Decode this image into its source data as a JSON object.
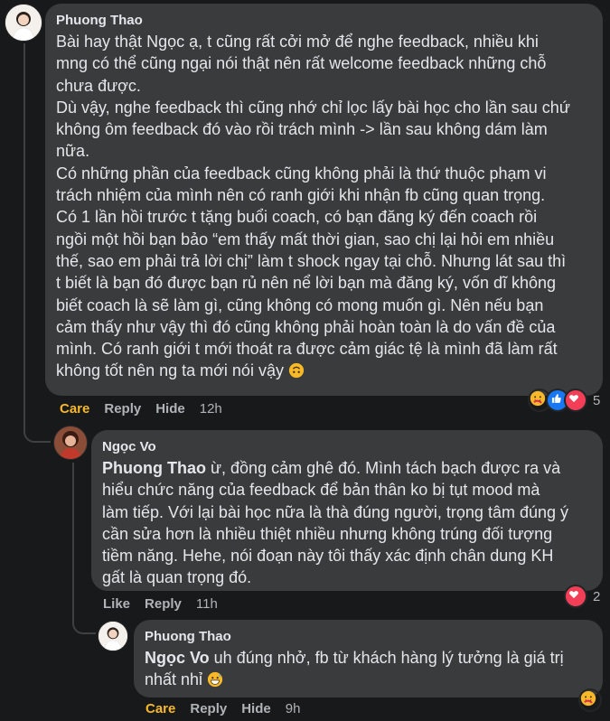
{
  "comments": [
    {
      "author": "Phuong Thao",
      "text": "Bài hay thật Ngọc ạ, t cũng rất cởi mở để nghe feedback, nhiều khi\nmng có thể cũng ngại nói thật nên rất welcome feedback những chỗ\nchưa được.\nDù vậy, nghe feedback thì cũng nhớ chỉ lọc lấy bài học cho lần sau chứ\nkhông ôm feedback đó vào rồi trách mình -> lần sau không dám làm\nnữa.\nCó những phần của feedback cũng không phải là thứ thuộc phạm vi\ntrách nhiệm của mình nên có ranh giới khi nhận fb cũng quan trọng.\nCó 1 lần hồi trước t tặng buổi coach, có bạn đăng ký đến coach rồi\nngồi một hồi bạn bảo “em thấy mất thời gian, sao chị lại hỏi em nhiều\nthế, sao em phải trả lời chị” làm t shock ngay tại chỗ. Nhưng lát sau thì\nt biết là bạn đó được bạn rủ nên nể lời bạn mà đăng ký, vốn dĩ không\nbiết coach là sẽ làm gì, cũng không có mong muốn gì. Nên nếu bạn\ncảm thấy như vậy thì đó cũng không phải hoàn toàn là do vấn đề của\nmình. Có ranh giới t mới thoát ra được cảm giác tệ là mình đã làm rất\nkhông tốt nên ng ta mới nói vậy",
      "actions": {
        "care": "Care",
        "reply": "Reply",
        "hide": "Hide",
        "time": "12h"
      },
      "reaction_count": "5",
      "reaction_icons": [
        "care-emoji",
        "like-emoji",
        "love-emoji"
      ],
      "inline_emoji": "upside-down-face"
    },
    {
      "author": "Ngọc Vo",
      "mention": "Phuong Thao",
      "text": " ừ, đồng cảm ghê đó. Mình tách bạch được ra và\nhiểu chức năng của feedback để bản thân ko bị tụt mood mà\nlàm tiếp. Với lại bài học nữa là thà đúng người, trọng tâm đúng ý\ncần sửa hơn là nhiều thiệt nhiều nhưng không trúng đối tượng\ntiềm năng. Hehe, nói đoạn này tôi thấy xác định chân dung KH\ngất là quan trọng đó.",
      "actions": {
        "like": "Like",
        "reply": "Reply",
        "time": "11h"
      },
      "reaction_count": "2",
      "reaction_icons": [
        "love-emoji"
      ]
    },
    {
      "author": "Phuong Thao",
      "mention": "Ngọc Vo",
      "text": " uh đúng nhở, fb từ khách hàng lý tưởng là giá trị\nnhất nhỉ",
      "actions": {
        "care": "Care",
        "reply": "Reply",
        "hide": "Hide",
        "time": "9h"
      },
      "reaction_icons": [
        "care-emoji"
      ],
      "inline_emoji": "grinning-sweat-face"
    }
  ]
}
